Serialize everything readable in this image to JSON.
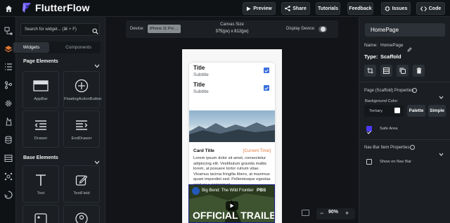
{
  "app": {
    "brand": "FlutterFlow",
    "accent": "#4b39ef"
  },
  "toolbar": {
    "preview": "Preview",
    "share": "Share",
    "tutorials": "Tutorials",
    "feedback": "Feedback",
    "issues": "Issues",
    "code": "Code"
  },
  "rail": {
    "icons": [
      "home-icon",
      "widget-tree-icon",
      "layers-icon",
      "list-icon",
      "branch-icon",
      "gear-icon",
      "firebase-icon",
      "database-icon",
      "table-icon",
      "api-icon",
      "custom-code-icon"
    ]
  },
  "widgets_panel": {
    "search_placeholder": "Search for widget... (⌘ + F)",
    "tabs": [
      "Widgets",
      "Components"
    ],
    "sections": [
      {
        "title": "Page Elements",
        "tiles": [
          "AppBar",
          "FloatingActionButton",
          "Drawer",
          "EndDrawer"
        ]
      },
      {
        "title": "Base Elements",
        "tiles": [
          "Text",
          "TextField"
        ]
      }
    ]
  },
  "canvas": {
    "device_label": "Device:",
    "device_value": "iPhone 11 Pro ...",
    "size_label": "Canvas Size",
    "size_value": "375(px) x 812(px)",
    "display_label": "Display Device:",
    "zoom": "90%"
  },
  "preview": {
    "list": [
      {
        "title": "Title",
        "subtitle": "Subtitle",
        "checked": true
      },
      {
        "title": "Title",
        "subtitle": "Subtitle",
        "checked": true
      }
    ],
    "card_title": "Card Title",
    "card_time": "[Current Time]",
    "card_body": "Lorem ipsum dolor sit amet, consectetur adipiscing elit. Vestibulum gravida mattis lorem, at posuere tortor rutrum vitae. Vivamus lacinia fringilla libero, at maximus quam imperdiet sed. Pellentesque egestas eget ex a consequat.",
    "video_title": "Big Bend: The Wild Frontier",
    "video_channel": "PBS",
    "video_big": "OFFICIAL TRAILER"
  },
  "props": {
    "page_name": "HomePage",
    "name_label": "Name:",
    "name_value": "HomePage",
    "type_label": "Type:",
    "type_value": "Scaffold",
    "scaffold_section": "Page (Scaffold) Properties",
    "bg_color_label": "Background Color",
    "bg_color_value": "Tertiary",
    "palette_btn": "Palette",
    "simple_btn": "Simple",
    "safe_area_label": "Safe Area",
    "safe_area_checked": true,
    "navbar_section": "Nav-Bar Item Properties",
    "show_navbar_label": "Show on Nav Bar",
    "show_navbar_checked": false
  }
}
